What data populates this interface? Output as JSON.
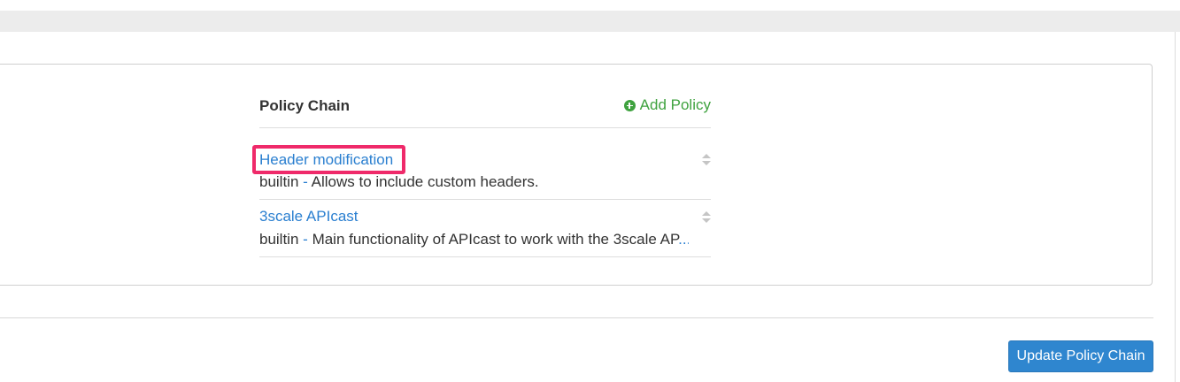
{
  "policy_chain": {
    "title": "Policy Chain",
    "add_policy_label": "Add Policy",
    "items": [
      {
        "name": "Header modification",
        "source": "builtin",
        "separator": "-",
        "description": "Allows to include custom headers.",
        "ellipsis": "",
        "highlighted": true
      },
      {
        "name": "3scale APIcast",
        "source": "builtin",
        "separator": "-",
        "description": "Main functionality of APIcast to work with the 3scale AP",
        "ellipsis": "...",
        "highlighted": false
      }
    ]
  },
  "footer": {
    "update_button_label": "Update Policy Chain"
  },
  "colors": {
    "link": "#2a7fd0",
    "add_policy": "#3fa23f",
    "highlight": "#ef2a6a",
    "primary_button": "#2f86cf",
    "gray_band": "#ececec"
  },
  "icons": {
    "add_policy": "plus-circle-icon",
    "reorder": "sort-icon"
  }
}
